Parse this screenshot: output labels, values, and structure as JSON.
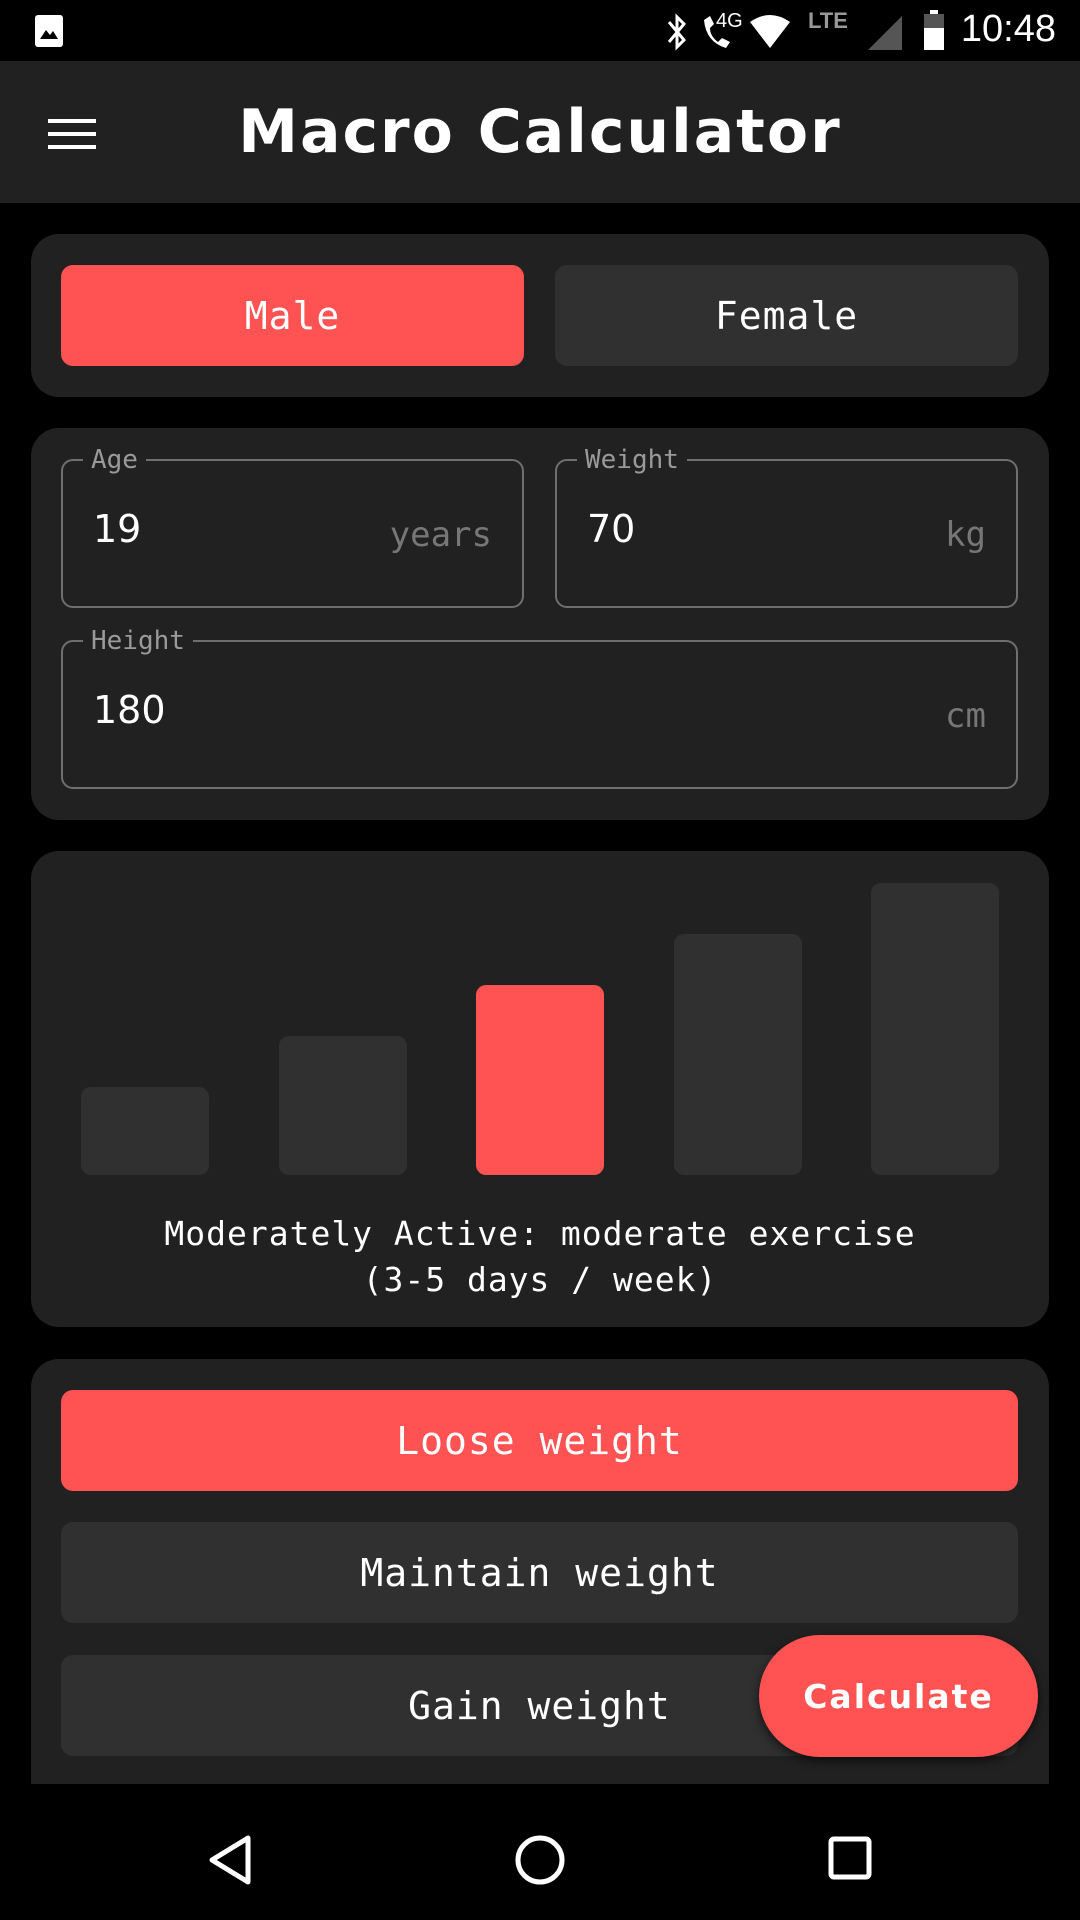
{
  "status_bar": {
    "time": "10:48",
    "icons": [
      "image-icon",
      "bluetooth-icon",
      "call-4g-icon",
      "wifi-icon",
      "lte-signal-icon",
      "battery-icon"
    ],
    "network_label": "LTE",
    "call_label": "4G"
  },
  "app_bar": {
    "title": "Macro Calculator",
    "menu_icon": "hamburger-menu-icon"
  },
  "colors": {
    "accent": "#FF5252",
    "card": "#212121",
    "inactive": "#303030",
    "background": "#000000"
  },
  "gender": {
    "options": [
      "Male",
      "Female"
    ],
    "selected": "Male"
  },
  "fields": {
    "age": {
      "label": "Age",
      "value": "19",
      "unit": "years"
    },
    "weight": {
      "label": "Weight",
      "value": "70",
      "unit": "kg"
    },
    "height": {
      "label": "Height",
      "value": "180",
      "unit": "cm"
    }
  },
  "activity": {
    "levels": [
      1,
      2,
      3,
      4,
      5
    ],
    "selected_index": 2,
    "description_line1": "Moderately Active: moderate exercise",
    "description_line2": "(3-5 days / week)"
  },
  "goal": {
    "options": [
      "Loose weight",
      "Maintain weight",
      "Gain weight"
    ],
    "selected": "Loose weight"
  },
  "fab": {
    "label": "Calculate"
  },
  "nav_bar": {
    "icons": [
      "back-icon",
      "home-icon",
      "recents-icon"
    ]
  }
}
